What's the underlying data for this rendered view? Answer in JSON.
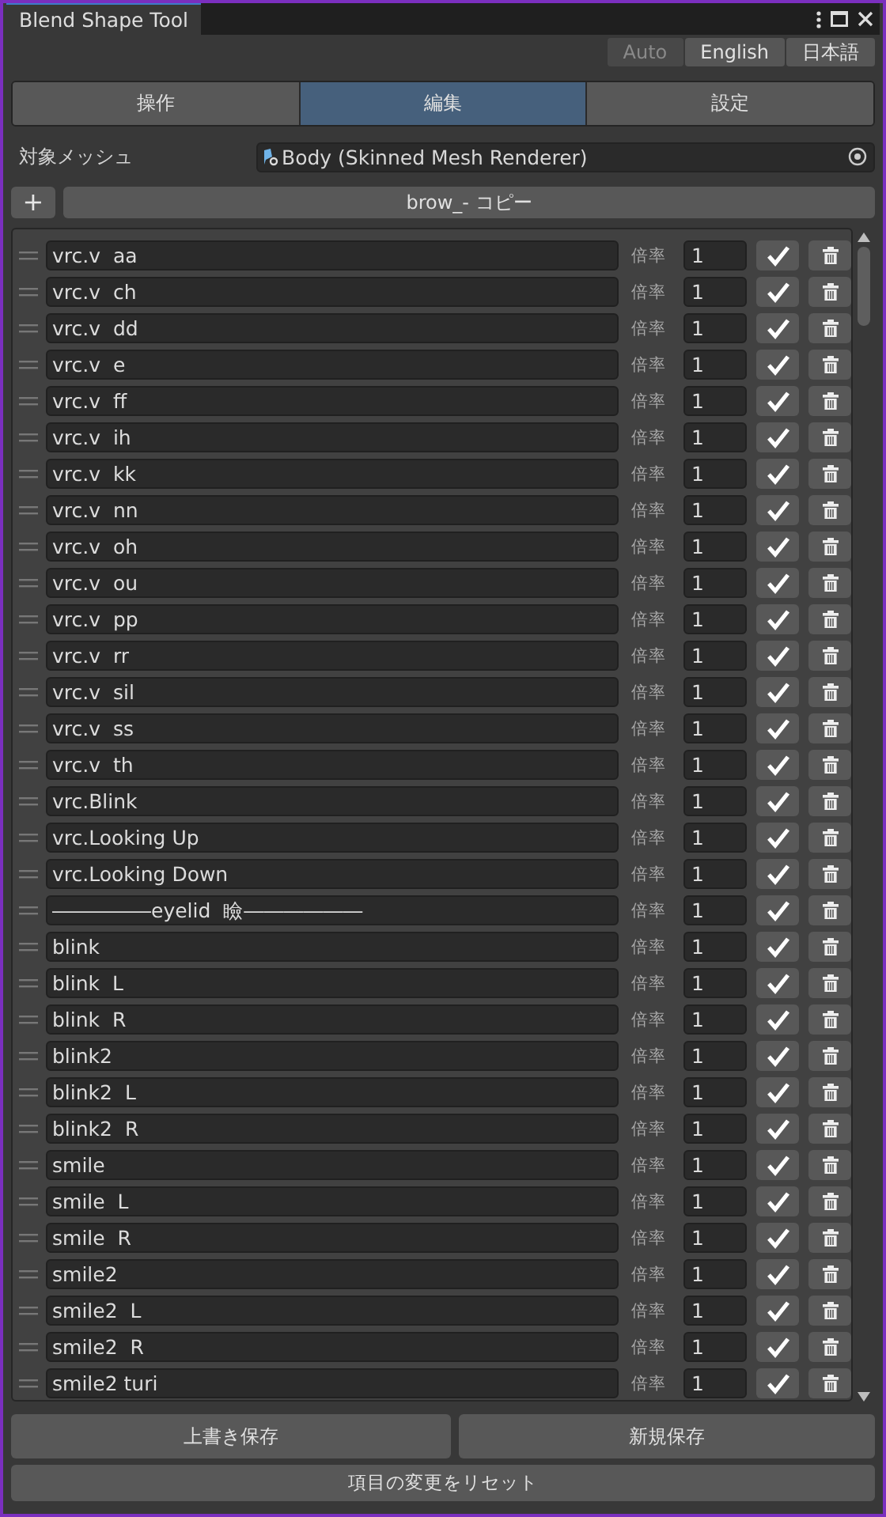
{
  "window": {
    "title": "Blend Shape Tool"
  },
  "languages": [
    {
      "label": "Auto",
      "disabled": true
    },
    {
      "label": "English",
      "disabled": false
    },
    {
      "label": "日本語",
      "disabled": false
    }
  ],
  "tabs": [
    {
      "label": "操作",
      "selected": false
    },
    {
      "label": "編集",
      "selected": true
    },
    {
      "label": "設定",
      "selected": false
    }
  ],
  "target_mesh": {
    "label": "対象メッシュ",
    "value": "Body (Skinned Mesh Renderer)"
  },
  "add_button": "+",
  "preset_name": "brow_- コピー",
  "shapes": [
    {
      "name": "vrc.v  aa",
      "rate_label": "倍率",
      "rate": "1",
      "checked": true
    },
    {
      "name": "vrc.v  ch",
      "rate_label": "倍率",
      "rate": "1",
      "checked": true
    },
    {
      "name": "vrc.v  dd",
      "rate_label": "倍率",
      "rate": "1",
      "checked": true
    },
    {
      "name": "vrc.v  e",
      "rate_label": "倍率",
      "rate": "1",
      "checked": true
    },
    {
      "name": "vrc.v  ff",
      "rate_label": "倍率",
      "rate": "1",
      "checked": true
    },
    {
      "name": "vrc.v  ih",
      "rate_label": "倍率",
      "rate": "1",
      "checked": true
    },
    {
      "name": "vrc.v  kk",
      "rate_label": "倍率",
      "rate": "1",
      "checked": true
    },
    {
      "name": "vrc.v  nn",
      "rate_label": "倍率",
      "rate": "1",
      "checked": true
    },
    {
      "name": "vrc.v  oh",
      "rate_label": "倍率",
      "rate": "1",
      "checked": true
    },
    {
      "name": "vrc.v  ou",
      "rate_label": "倍率",
      "rate": "1",
      "checked": true
    },
    {
      "name": "vrc.v  pp",
      "rate_label": "倍率",
      "rate": "1",
      "checked": true
    },
    {
      "name": "vrc.v  rr",
      "rate_label": "倍率",
      "rate": "1",
      "checked": true
    },
    {
      "name": "vrc.v  sil",
      "rate_label": "倍率",
      "rate": "1",
      "checked": true
    },
    {
      "name": "vrc.v  ss",
      "rate_label": "倍率",
      "rate": "1",
      "checked": true
    },
    {
      "name": "vrc.v  th",
      "rate_label": "倍率",
      "rate": "1",
      "checked": true
    },
    {
      "name": "vrc.Blink",
      "rate_label": "倍率",
      "rate": "1",
      "checked": true
    },
    {
      "name": "vrc.Looking Up",
      "rate_label": "倍率",
      "rate": "1",
      "checked": true
    },
    {
      "name": "vrc.Looking Down",
      "rate_label": "倍率",
      "rate": "1",
      "checked": true
    },
    {
      "name": "―――――eyelid  瞼――――――",
      "rate_label": "倍率",
      "rate": "1",
      "checked": true
    },
    {
      "name": "blink",
      "rate_label": "倍率",
      "rate": "1",
      "checked": true
    },
    {
      "name": "blink  L",
      "rate_label": "倍率",
      "rate": "1",
      "checked": true
    },
    {
      "name": "blink  R",
      "rate_label": "倍率",
      "rate": "1",
      "checked": true
    },
    {
      "name": "blink2",
      "rate_label": "倍率",
      "rate": "1",
      "checked": true
    },
    {
      "name": "blink2  L",
      "rate_label": "倍率",
      "rate": "1",
      "checked": true
    },
    {
      "name": "blink2  R",
      "rate_label": "倍率",
      "rate": "1",
      "checked": true
    },
    {
      "name": "smile",
      "rate_label": "倍率",
      "rate": "1",
      "checked": true
    },
    {
      "name": "smile  L",
      "rate_label": "倍率",
      "rate": "1",
      "checked": true
    },
    {
      "name": "smile  R",
      "rate_label": "倍率",
      "rate": "1",
      "checked": true
    },
    {
      "name": "smile2",
      "rate_label": "倍率",
      "rate": "1",
      "checked": true
    },
    {
      "name": "smile2  L",
      "rate_label": "倍率",
      "rate": "1",
      "checked": true
    },
    {
      "name": "smile2  R",
      "rate_label": "倍率",
      "rate": "1",
      "checked": true
    },
    {
      "name": "smile2 turi",
      "rate_label": "倍率",
      "rate": "1",
      "checked": true
    }
  ],
  "save_buttons": [
    "上書き保存",
    "新規保存"
  ],
  "reset_button": "項目の変更をリセット"
}
